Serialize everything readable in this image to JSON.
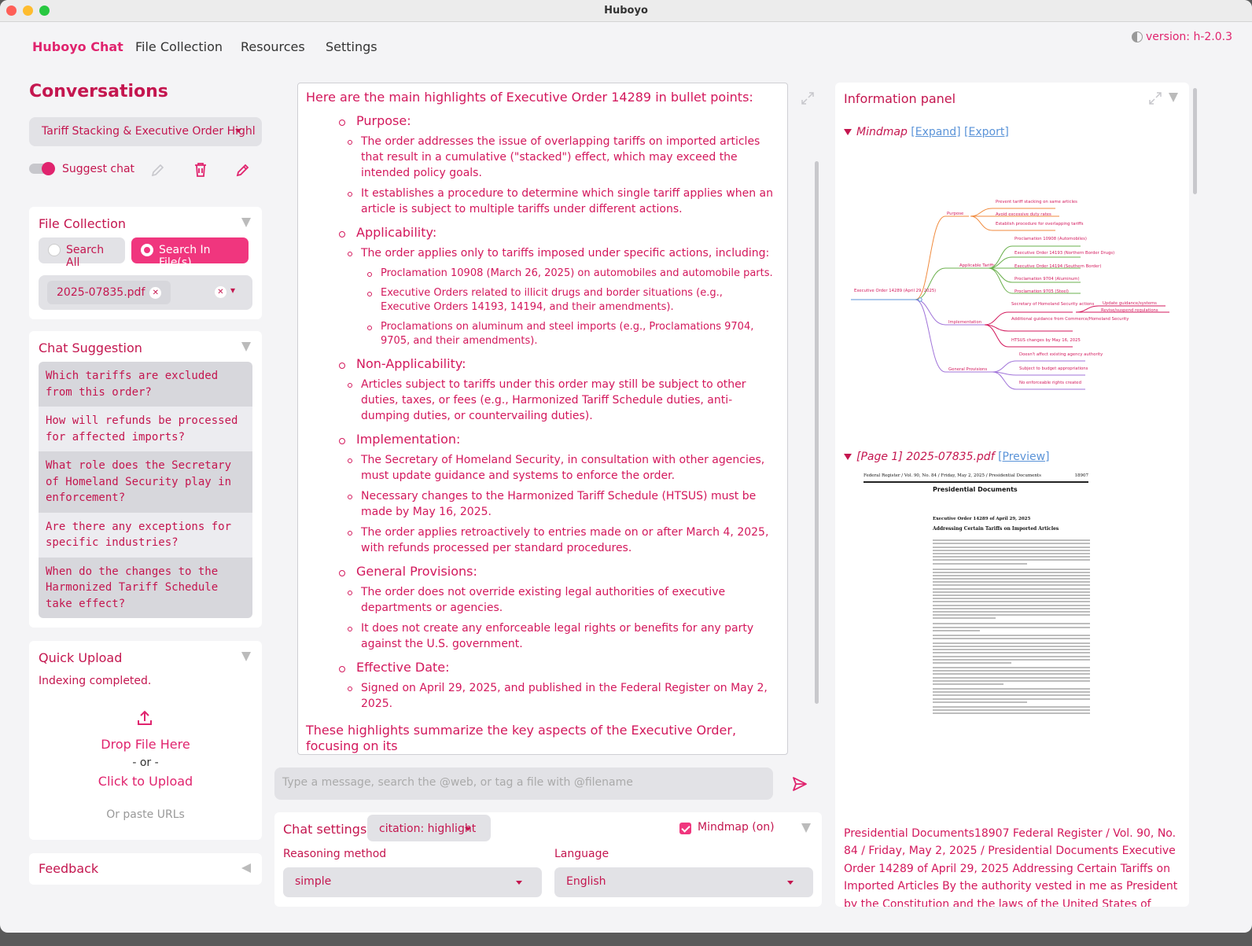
{
  "window": {
    "title": "Huboyo"
  },
  "nav": {
    "tabs": [
      "Huboyo Chat",
      "File Collection",
      "Resources",
      "Settings"
    ],
    "version": "version: h-2.0.3"
  },
  "sidebar": {
    "conversations_title": "Conversations",
    "selected_conversation": "Tariff Stacking & Executive Order Highl",
    "suggest_chat_label": "Suggest chat",
    "file_collection": {
      "title": "File Collection",
      "search_all": "Search All",
      "search_in_files": "Search In File(s)",
      "selected_file": "2025-07835.pdf"
    },
    "chat_suggestion": {
      "title": "Chat Suggestion",
      "items": [
        "Which tariffs are excluded from this order?",
        "How will refunds be processed for affected imports?",
        "What role does the Secretary of Homeland Security play in enforcement?",
        "Are there any exceptions for specific industries?",
        "When do the changes to the Harmonized Tariff Schedule take effect?"
      ]
    },
    "quick_upload": {
      "title": "Quick Upload",
      "status": "Indexing completed.",
      "drop": "Drop File Here",
      "or": "- or -",
      "click": "Click to Upload",
      "paste": "Or paste URLs"
    },
    "feedback": "Feedback"
  },
  "chat": {
    "intro": "Here are the main highlights of Executive Order 14289 in bullet points:",
    "sections": [
      {
        "heading": "Purpose",
        "items": [
          "The order addresses the issue of overlapping tariffs on imported articles that result in a cumulative (\"stacked\") effect, which may exceed the intended policy goals.",
          "It establishes a procedure to determine which single tariff applies when an article is subject to multiple tariffs under different actions."
        ]
      },
      {
        "heading": "Applicability",
        "items": [
          "The order applies only to tariffs imposed under specific actions, including:"
        ],
        "subitems": [
          "Proclamation 10908 (March 26, 2025) on automobiles and automobile parts.",
          "Executive Orders related to illicit drugs and border situations (e.g., Executive Orders 14193, 14194, and their amendments).",
          "Proclamations on aluminum and steel imports (e.g., Proclamations 9704, 9705, and their amendments)."
        ]
      },
      {
        "heading": "Non-Applicability",
        "items": [
          "Articles subject to tariffs under this order may still be subject to other duties, taxes, or fees (e.g., Harmonized Tariff Schedule duties, anti-dumping duties, or countervailing duties)."
        ]
      },
      {
        "heading": "Implementation",
        "items": [
          "The Secretary of Homeland Security, in consultation with other agencies, must update guidance and systems to enforce the order.",
          "Necessary changes to the Harmonized Tariff Schedule (HTSUS) must be made by May 16, 2025.",
          "The order applies retroactively to entries made on or after March 4, 2025, with refunds processed per standard procedures."
        ]
      },
      {
        "heading": "General Provisions",
        "items": [
          "The order does not override existing legal authorities of executive departments or agencies.",
          "It does not create any enforceable legal rights or benefits for any party against the U.S. government."
        ]
      },
      {
        "heading": "Effective Date",
        "items": [
          "Signed on April 29, 2025, and published in the Federal Register on May 2, 2025."
        ]
      }
    ],
    "outro": "These highlights summarize the key aspects of the Executive Order, focusing on its",
    "input_placeholder": "Type a message, search the @web, or tag a file with @filename"
  },
  "chat_settings": {
    "title": "Chat settings",
    "citation": "citation: highlight",
    "mindmap": "Mindmap (on)",
    "reasoning_label": "Reasoning method",
    "reasoning_value": "simple",
    "language_label": "Language",
    "language_value": "English"
  },
  "info_panel": {
    "title": "Information panel",
    "mindmap_label": "Mindmap",
    "expand": "[Expand]",
    "export": "[Export]",
    "page_label": "[Page 1] 2025-07835.pdf",
    "preview": "[Preview]",
    "mindmap": {
      "root": "Executive Order 14289 (April 29, 2025)",
      "branches": [
        {
          "name": "Purpose",
          "leaves": [
            "Prevent tariff stacking on same articles",
            "Avoid excessive duty rates",
            "Establish procedure for overlapping tariffs"
          ]
        },
        {
          "name": "Applicable Tariffs",
          "leaves": [
            "Proclamation 10908 (Automobiles)",
            "Executive Order 14193 (Northern Border Drugs)",
            "Executive Order 14194 (Southern Border)",
            "Proclamation 9704 (Aluminum)",
            "Proclamation 9705 (Steel)"
          ]
        },
        {
          "name": "Implementation",
          "leaves": [
            "Secretary of Homeland Security actions",
            "Additional guidance from Commerce/Homeland Security",
            "HTSUS changes by May 16, 2025"
          ],
          "subleaves": [
            "Update guidance/systems",
            "Revise/suspend regulations"
          ]
        },
        {
          "name": "General Provisions",
          "leaves": [
            "Doesn't affect existing agency authority",
            "Subject to budget appropriations",
            "No enforceable rights created"
          ]
        }
      ]
    },
    "pdf": {
      "header_left": "Federal Register / Vol. 90, No. 84 / Friday, May 2, 2025 / Presidential Documents",
      "header_right": "18907",
      "section": "Presidential Documents",
      "eo_title": "Executive Order 14289 of April 29, 2025",
      "eo_subtitle": "Addressing Certain Tariffs on Imported Articles"
    },
    "excerpt": "Presidential Documents18907 Federal Register / Vol. 90, No. 84 / Friday, May 2, 2025 / Presidential Documents Executive Order 14289 of April 29, 2025 Addressing Certain Tariffs on Imported Articles By the authority vested in me as President by the Constitution and the laws of the United States of America"
  },
  "colors": {
    "accent": "#e0246e",
    "text": "#c4164f",
    "link": "#5a93d8"
  }
}
